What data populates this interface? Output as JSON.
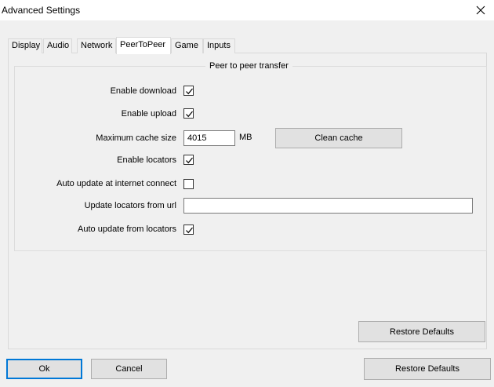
{
  "window": {
    "title": "Advanced Settings"
  },
  "tabs": [
    {
      "label": "Display"
    },
    {
      "label": "Audio"
    },
    {
      "label": "Network"
    },
    {
      "label": "PeerToPeer"
    },
    {
      "label": "Game"
    },
    {
      "label": "Inputs"
    }
  ],
  "active_tab": "PeerToPeer",
  "group": {
    "title": "Peer to peer transfer",
    "enable_download": {
      "label": "Enable download",
      "checked": true
    },
    "enable_upload": {
      "label": "Enable upload",
      "checked": true
    },
    "max_cache": {
      "label": "Maximum cache size",
      "value": "4015",
      "unit": "MB"
    },
    "clean_cache_label": "Clean cache",
    "enable_locators": {
      "label": "Enable locators",
      "checked": true
    },
    "auto_update_connect": {
      "label": "Auto update at internet connect",
      "checked": false
    },
    "update_url": {
      "label": "Update locators from url",
      "value": ""
    },
    "auto_update_locators": {
      "label": "Auto update from locators",
      "checked": true
    }
  },
  "tab_restore_defaults_label": "Restore Defaults",
  "footer": {
    "ok_label": "Ok",
    "cancel_label": "Cancel",
    "restore_defaults_label": "Restore Defaults"
  }
}
